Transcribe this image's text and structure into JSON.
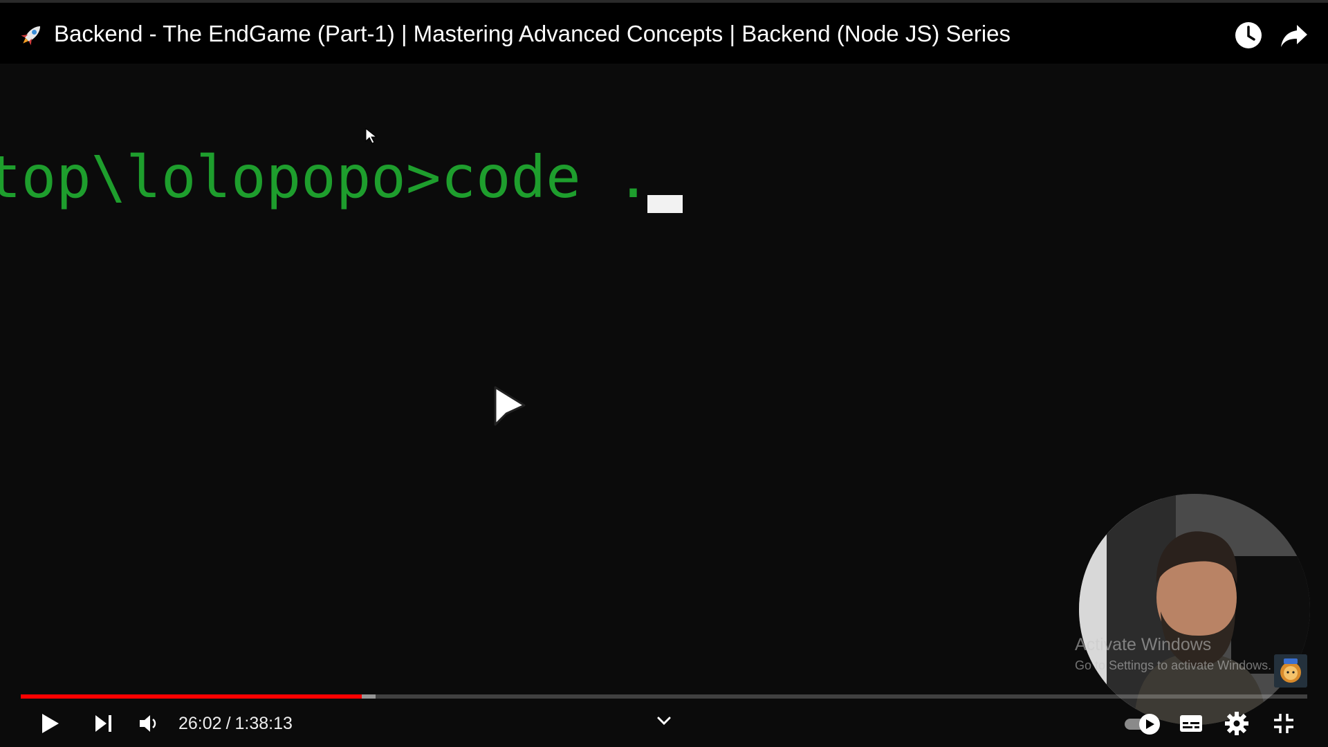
{
  "header": {
    "title": "Backend - The EndGame (Part-1) | Mastering Advanced Concepts | Backend (Node JS) Series",
    "logo_icon": "rocket-icon",
    "actions": [
      {
        "name": "watch-later",
        "icon": "clock-icon"
      },
      {
        "name": "share",
        "icon": "share-arrow-icon"
      }
    ]
  },
  "video": {
    "terminal_text": "top\\lolopopo>code .",
    "terminal_color": "#1e9e2d",
    "webcam_icon": "presenter-webcam"
  },
  "watermark": {
    "title": "Activate Windows",
    "subtitle": "Go to Settings to activate Windows."
  },
  "player": {
    "current_time": "26:02",
    "separator": "/",
    "duration": "1:38:13",
    "progress_fraction": 0.265,
    "buffered_fraction": 0.276,
    "progress_color": "#ff0000",
    "controls": [
      {
        "name": "play",
        "icon": "play-icon"
      },
      {
        "name": "next",
        "icon": "skip-next-icon"
      },
      {
        "name": "volume",
        "icon": "volume-icon"
      },
      {
        "name": "more",
        "icon": "chevron-down-icon"
      },
      {
        "name": "autoplay",
        "icon": "autoplay-toggle-icon"
      },
      {
        "name": "captions",
        "icon": "subtitles-icon"
      },
      {
        "name": "settings",
        "icon": "gear-icon"
      },
      {
        "name": "exit-fullscreen",
        "icon": "fullscreen-exit-icon"
      }
    ]
  }
}
